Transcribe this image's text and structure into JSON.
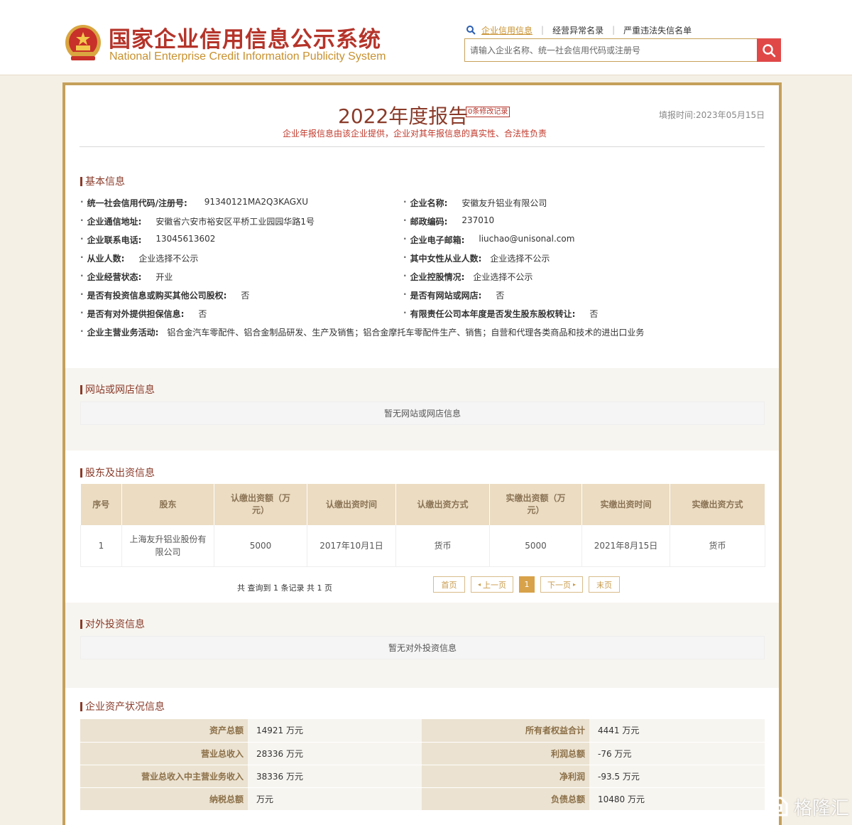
{
  "header": {
    "title_cn": "国家企业信用信息公示系统",
    "title_en": "National Enterprise Credit Information Publicity System",
    "links": [
      "企业信用信息",
      "经营异常名录",
      "严重违法失信名单"
    ],
    "search_placeholder": "请输入企业名称、统一社会信用代码或注册号"
  },
  "report": {
    "title": "2022年度报告",
    "mod_badge": "0条修改记录",
    "fill_date": "填报时间:2023年05月15日",
    "disclaimer": "企业年报信息由该企业提供，企业对其年报信息的真实性、合法性负责"
  },
  "basic": {
    "section_title": "基本信息",
    "fields": [
      {
        "label": "统一社会信用代码/注册号:",
        "value": "91340121MA2Q3KAGXU"
      },
      {
        "label": "企业名称:",
        "value": "安徽友升铝业有限公司"
      },
      {
        "label": "企业通信地址:",
        "value": "安徽省六安市裕安区平桥工业园园华路1号"
      },
      {
        "label": "邮政编码:",
        "value": "237010"
      },
      {
        "label": "企业联系电话:",
        "value": "13045613602"
      },
      {
        "label": "企业电子邮箱:",
        "value": "liuchao@unisonal.com"
      },
      {
        "label": "从业人数:",
        "value": "企业选择不公示"
      },
      {
        "label": "其中女性从业人数:",
        "value": "企业选择不公示"
      },
      {
        "label": "企业经营状态:",
        "value": "开业"
      },
      {
        "label": "企业控股情况:",
        "value": "企业选择不公示"
      },
      {
        "label": "是否有投资信息或购买其他公司股权:",
        "value": "否"
      },
      {
        "label": "是否有网站或网店:",
        "value": "否"
      },
      {
        "label": "是否有对外提供担保信息:",
        "value": "否"
      },
      {
        "label": "有限责任公司本年度是否发生股东股权转让:",
        "value": "否"
      },
      {
        "label": "企业主营业务活动:",
        "value": "铝合金汽车零配件、铝合金制品研发、生产及销售；铝合金摩托车零配件生产、销售；自营和代理各类商品和技术的进出口业务"
      }
    ]
  },
  "website": {
    "section_title": "网站或网店信息",
    "empty_text": "暂无网站或网店信息"
  },
  "shareholders": {
    "section_title": "股东及出资信息",
    "columns": [
      "序号",
      "股东",
      "认缴出资额（万元）",
      "认缴出资时间",
      "认缴出资方式",
      "实缴出资额（万元）",
      "实缴出资时间",
      "实缴出资方式"
    ],
    "rows": [
      [
        "1",
        "上海友升铝业股份有限公司",
        "5000",
        "2017年10月1日",
        "货币",
        "5000",
        "2021年8月15日",
        "货币"
      ]
    ],
    "pager_info": "共 查询到 1 条记录 共 1 页",
    "pager": {
      "first": "首页",
      "prev": "上一页",
      "current": "1",
      "next": "下一页",
      "last": "末页"
    }
  },
  "investment": {
    "section_title": "对外投资信息",
    "empty_text": "暂无对外投资信息"
  },
  "assets": {
    "section_title": "企业资产状况信息",
    "rows": [
      [
        {
          "label": "资产总额",
          "value": "14921 万元"
        },
        {
          "label": "所有者权益合计",
          "value": "4441 万元"
        }
      ],
      [
        {
          "label": "营业总收入",
          "value": "28336 万元"
        },
        {
          "label": "利润总额",
          "value": "-76 万元"
        }
      ],
      [
        {
          "label": "营业总收入中主营业务收入",
          "value": "38336 万元"
        },
        {
          "label": "净利润",
          "value": "-93.5 万元"
        }
      ],
      [
        {
          "label": "纳税总额",
          "value": "万元"
        },
        {
          "label": "负债总额",
          "value": "10480 万元"
        }
      ]
    ]
  },
  "watermark": {
    "text": "格隆汇"
  },
  "colors": {
    "brand_red": "#b5342a",
    "gold": "#c5a05a",
    "header_gold_text": "#c8912f",
    "section_brown": "#8a3b2a",
    "search_btn": "#e04848"
  }
}
